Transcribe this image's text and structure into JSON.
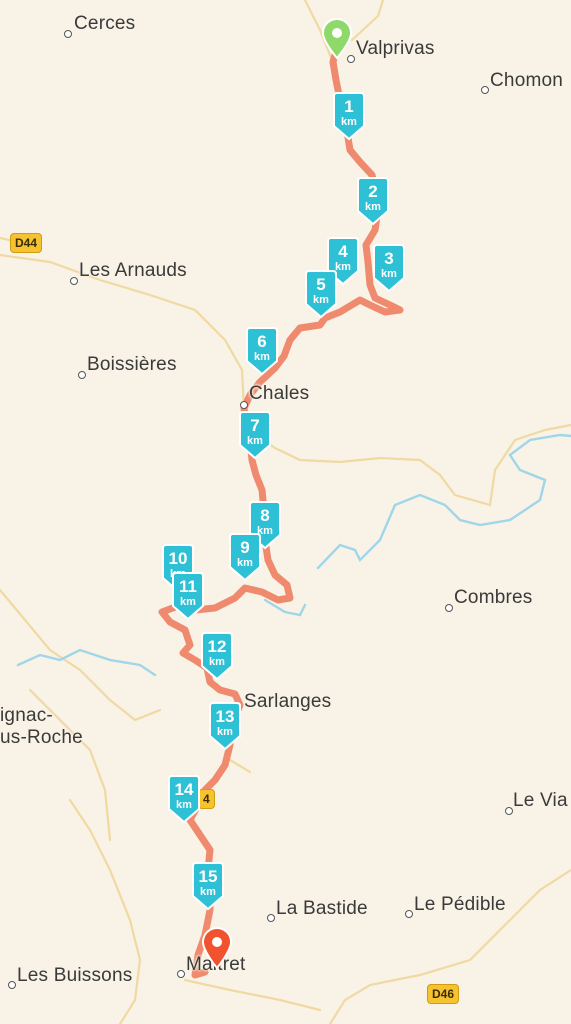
{
  "places": [
    {
      "name": "Cerces"
    },
    {
      "name": "Valprivas"
    },
    {
      "name": "Chomon"
    },
    {
      "name": "Les Arnauds"
    },
    {
      "name": "Boissières"
    },
    {
      "name": "Chales"
    },
    {
      "name": "Combres"
    },
    {
      "name": "Sarlanges"
    },
    {
      "name": "ignac-"
    },
    {
      "name": "us-Roche"
    },
    {
      "name": "Le Via"
    },
    {
      "name": "La Bastide"
    },
    {
      "name": "Le Pédible"
    },
    {
      "name": "Les Buissons"
    },
    {
      "name": "Maltret"
    }
  ],
  "road_shields": [
    {
      "label": "D44"
    },
    {
      "label": "4"
    },
    {
      "label": "D46"
    }
  ],
  "km_markers": [
    {
      "number": "1",
      "unit": "km"
    },
    {
      "number": "2",
      "unit": "km"
    },
    {
      "number": "3",
      "unit": "km"
    },
    {
      "number": "4",
      "unit": "km"
    },
    {
      "number": "5",
      "unit": "km"
    },
    {
      "number": "6",
      "unit": "km"
    },
    {
      "number": "7",
      "unit": "km"
    },
    {
      "number": "8",
      "unit": "km"
    },
    {
      "number": "9",
      "unit": "km"
    },
    {
      "number": "10",
      "unit": "km"
    },
    {
      "number": "11",
      "unit": "km"
    },
    {
      "number": "12",
      "unit": "km"
    },
    {
      "number": "13",
      "unit": "km"
    },
    {
      "number": "14",
      "unit": "km"
    },
    {
      "number": "15",
      "unit": "km"
    }
  ],
  "colors": {
    "background": "#f8f3e6",
    "route": "#ef8a6e",
    "km_marker": "#2ec0d4",
    "water": "#9fd6ea",
    "road": "#f0d9a2",
    "start_pin": "#8ed96a",
    "end_pin": "#f0532e",
    "road_shield": "#f5c230"
  }
}
